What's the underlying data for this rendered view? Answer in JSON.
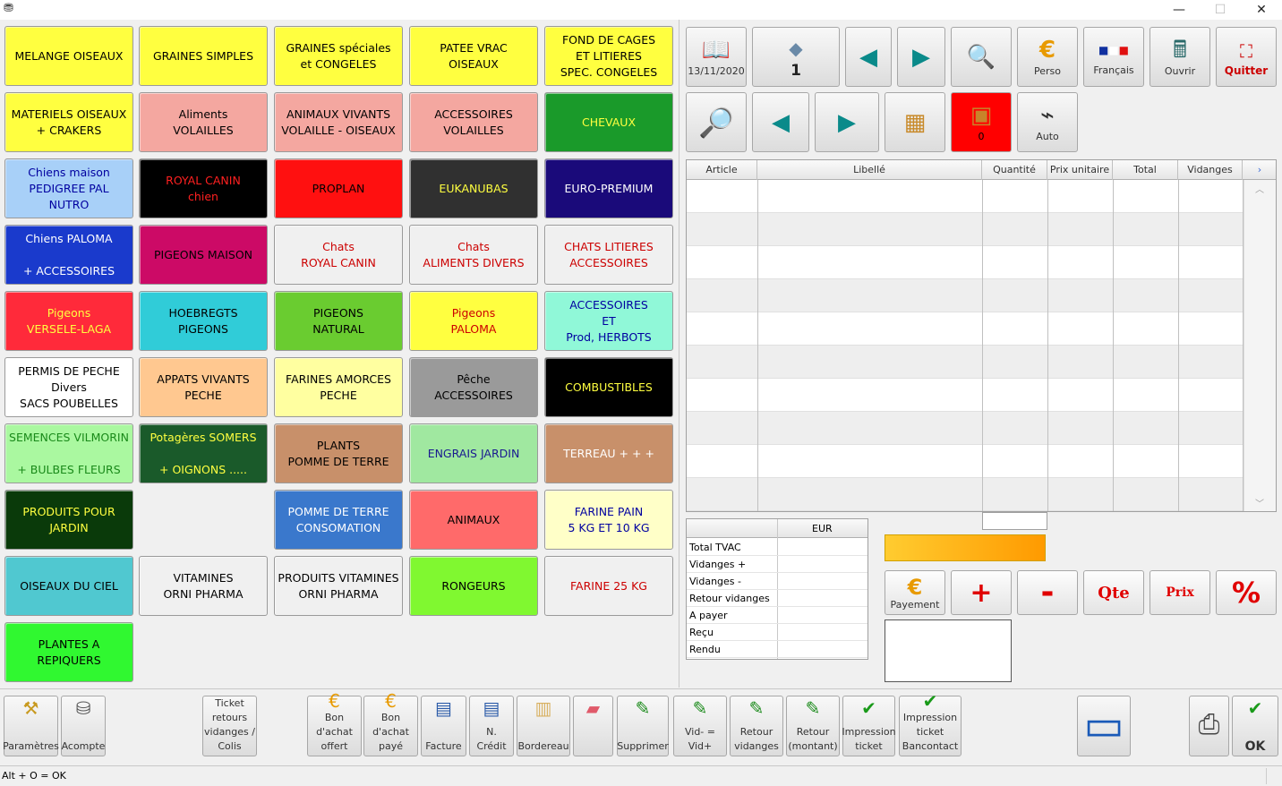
{
  "window": {
    "app_icon": "app-icon",
    "minimize": "—",
    "maximize": "☐",
    "close": "✕"
  },
  "categories": [
    {
      "label": "MELANGE OISEAUX",
      "bg": "#ffff40",
      "fg": "#000000"
    },
    {
      "label": "GRAINES SIMPLES",
      "bg": "#ffff40",
      "fg": "#000000"
    },
    {
      "label": "GRAINES spéciales\net  CONGELES",
      "bg": "#ffff40",
      "fg": "#000000"
    },
    {
      "label": "PATEE   VRAC\nOISEAUX",
      "bg": "#ffff40",
      "fg": "#000000"
    },
    {
      "label": "FOND DE CAGES\nET LITIERES\nSPEC. CONGELES",
      "bg": "#ffff40",
      "fg": "#000000"
    },
    {
      "label": "MATERIELS  OISEAUX\n+   CRAKERS",
      "bg": "#ffff40",
      "fg": "#000000"
    },
    {
      "label": "Aliments\nVOLAILLES",
      "bg": "#f4a7a0",
      "fg": "#000000"
    },
    {
      "label": "ANIMAUX VIVANTS\nVOLAILLE - OISEAUX",
      "bg": "#f4a7a0",
      "fg": "#000000"
    },
    {
      "label": "ACCESSOIRES\nVOLAILLES",
      "bg": "#f4a7a0",
      "fg": "#000000"
    },
    {
      "label": "CHEVAUX",
      "bg": "#1a9a2a",
      "fg": "#ffff40"
    },
    {
      "label": "Chiens maison\nPEDIGREE  PAL\nNUTRO",
      "bg": "#a8d0f8",
      "fg": "#0000a0"
    },
    {
      "label": "ROYAL CANIN\nchien",
      "bg": "#000000",
      "fg": "#ff2020"
    },
    {
      "label": "PROPLAN",
      "bg": "#ff1010",
      "fg": "#000000"
    },
    {
      "label": "EUKANUBAS",
      "bg": "#303030",
      "fg": "#ffff40"
    },
    {
      "label": "EURO-PREMIUM",
      "bg": "#1a0a7a",
      "fg": "#ffffff"
    },
    {
      "label": "Chiens PALOMA\n\n+ ACCESSOIRES",
      "bg": "#1a3acc",
      "fg": "#ffffff"
    },
    {
      "label": "PIGEONS MAISON",
      "bg": "#cc0a66",
      "fg": "#000000"
    },
    {
      "label": "Chats\nROYAL CANIN",
      "bg": "#f0f0f0",
      "fg": "#cc0000"
    },
    {
      "label": "Chats\nALIMENTS  DIVERS",
      "bg": "#f0f0f0",
      "fg": "#cc0000"
    },
    {
      "label": "CHATS  LITIERES\nACCESSOIRES",
      "bg": "#f0f0f0",
      "fg": "#cc0000"
    },
    {
      "label": "Pigeons\nVERSELE-LAGA",
      "bg": "#ff2a3a",
      "fg": "#ffff40"
    },
    {
      "label": "HOEBREGTS\nPIGEONS",
      "bg": "#30ccd8",
      "fg": "#000000"
    },
    {
      "label": "PIGEONS\nNATURAL",
      "bg": "#6acc30",
      "fg": "#000000"
    },
    {
      "label": "Pigeons\nPALOMA",
      "bg": "#ffff40",
      "fg": "#cc0000"
    },
    {
      "label": "ACCESSOIRES\nET\nProd,      HERBOTS",
      "bg": "#90f8d8",
      "fg": "#0000a0"
    },
    {
      "label": "PERMIS  DE PECHE\nDivers\nSACS   POUBELLES",
      "bg": "#ffffff",
      "fg": "#000000"
    },
    {
      "label": "APPATS  VIVANTS\nPECHE",
      "bg": "#ffc890",
      "fg": "#000000"
    },
    {
      "label": "FARINES AMORCES\nPECHE",
      "bg": "#ffffa0",
      "fg": "#000000"
    },
    {
      "label": "Pêche\nACCESSOIRES",
      "bg": "#9a9a9a",
      "fg": "#000000"
    },
    {
      "label": "COMBUSTIBLES",
      "bg": "#000000",
      "fg": "#ffff40"
    },
    {
      "label": "SEMENCES  VILMORIN\n\n+ BULBES FLEURS",
      "bg": "#aaf8a0",
      "fg": "#1a8a1a"
    },
    {
      "label": "Potagères SOMERS\n\n+ OIGNONS .....",
      "bg": "#1a5a2a",
      "fg": "#ffff40"
    },
    {
      "label": "PLANTS\nPOMME  DE  TERRE",
      "bg": "#c8906a",
      "fg": "#000000"
    },
    {
      "label": "ENGRAIS JARDIN",
      "bg": "#a0e8a0",
      "fg": "#1a1a90"
    },
    {
      "label": "TERREAU  + + +",
      "bg": "#c8906a",
      "fg": "#ffffff"
    },
    {
      "label": "PRODUITS POUR\nJARDIN",
      "bg": "#0a3a0a",
      "fg": "#ffff40"
    },
    {
      "label": "",
      "bg": "transparent",
      "fg": "#000000"
    },
    {
      "label": "POMME DE TERRE\nCONSOMATION",
      "bg": "#3a78cc",
      "fg": "#ffffff"
    },
    {
      "label": "ANIMAUX",
      "bg": "#ff6a6a",
      "fg": "#000000"
    },
    {
      "label": "FARINE  PAIN\n5  KG  ET  10 KG",
      "bg": "#ffffc8",
      "fg": "#0000a0"
    },
    {
      "label": "OISEAUX DU CIEL",
      "bg": "#50c8d0",
      "fg": "#000000"
    },
    {
      "label": "VITAMINES\nORNI   PHARMA",
      "bg": "#f0f0f0",
      "fg": "#000000"
    },
    {
      "label": "PRODUITS VITAMINES\nORNI  PHARMA",
      "bg": "#f0f0f0",
      "fg": "#000000"
    },
    {
      "label": "RONGEURS",
      "bg": "#80f830",
      "fg": "#000000"
    },
    {
      "label": "FARINE  25 KG",
      "bg": "#f0f0f0",
      "fg": "#cc0000"
    },
    {
      "label": "PLANTES A REPIQUERS",
      "bg": "#30f830",
      "fg": "#000000"
    }
  ],
  "toolbar": {
    "date": "13/11/2020",
    "page_num": "1",
    "perso": "Perso",
    "lang": "Français",
    "open": "Ouvrir",
    "quit": "Quitter",
    "count": "0",
    "auto": "Auto"
  },
  "grid": {
    "columns": [
      "Article",
      "Libellé",
      "Quantité",
      "Prix unitaire",
      "Total",
      "Vidanges"
    ],
    "scroll_right": "›"
  },
  "totals": {
    "currency": "EUR",
    "rows": [
      "Total TVAC",
      "Vidanges +",
      "Vidanges -",
      "Retour vidanges",
      "A payer",
      "Reçu",
      "Rendu"
    ]
  },
  "actions": {
    "payment": "Payement",
    "plus": "+",
    "minus": "-",
    "qty": "Qte",
    "price": "Prix",
    "percent": "%"
  },
  "bottom": [
    {
      "label": "Paramètres",
      "icon": "tools-icon"
    },
    {
      "label": "Acompte",
      "icon": "coins-icon"
    },
    {
      "label": "Ticket\nretours\nvidanges /\nColis",
      "icon": ""
    },
    {
      "label": "Bon\nd'achat\noffert",
      "icon": "euro-icon"
    },
    {
      "label": "Bon\nd'achat\npayé",
      "icon": "euro-icon"
    },
    {
      "label": "Facture",
      "icon": "document-icon"
    },
    {
      "label": "N.\nCrédit",
      "icon": "document-icon"
    },
    {
      "label": "Bordereau",
      "icon": "paper-icon"
    },
    {
      "label": "",
      "icon": "eraser-icon"
    },
    {
      "label": "Supprimer",
      "icon": "bottle-icon"
    },
    {
      "label": "Vid- = Vid+",
      "icon": "bottle-icon"
    },
    {
      "label": "Retour\nvidanges",
      "icon": "bottle-icon"
    },
    {
      "label": "Retour\n(montant)",
      "icon": "bottle-icon"
    },
    {
      "label": "Impression\nticket",
      "icon": "check-icon"
    },
    {
      "label": "Impression\nticket\nBancontact",
      "icon": "check-icon"
    },
    {
      "label": "",
      "icon": "bancontact-icon"
    },
    {
      "label": "",
      "icon": "printer-icon"
    },
    {
      "label": "OK",
      "icon": "check-icon"
    }
  ],
  "status": "Alt + O = OK"
}
